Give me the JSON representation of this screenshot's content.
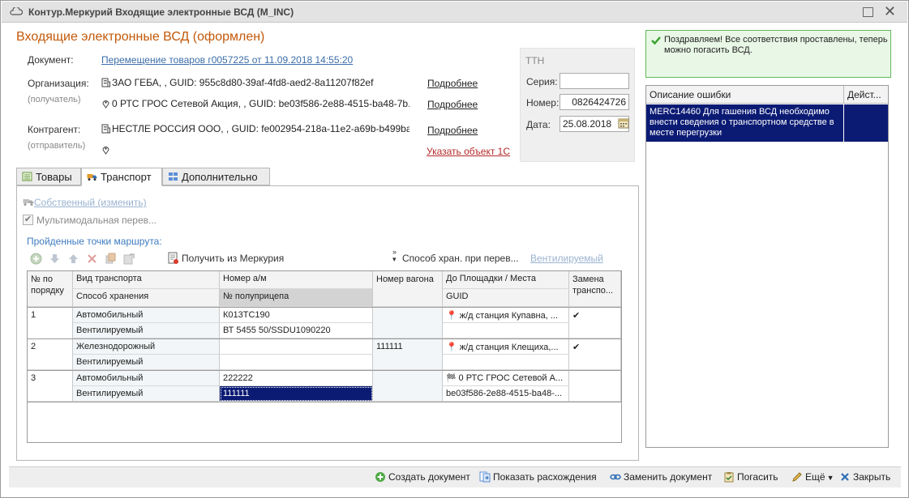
{
  "window": {
    "title": "Контур.Меркурий Входящие электронные ВСД (M_INC)"
  },
  "header": {
    "title": "Входящие электронные ВСД (оформлен)"
  },
  "document": {
    "label": "Документ:",
    "link": "Перемещение товаров г0057225 от 11.09.2018 14:55:20"
  },
  "organization": {
    "label": "Организация:",
    "sublabel": "(получатель)",
    "line1": "ЗАО ГЕБА, , GUID: 955c8d80-39af-4fd8-aed2-8a11207f82ef",
    "line2": "0 РТС ГРОС Сетевой Акция, , GUID: be03f586-2e88-4515-ba48-7b...",
    "more1": "Подробнее",
    "more2": "Подробнее"
  },
  "contragent": {
    "label": "Контрагент:",
    "sublabel": "(отправитель)",
    "line1": "НЕСТЛЕ РОССИЯ ООО, , GUID: fe002954-218a-11e2-a69b-b499ba...",
    "more": "Подробнее",
    "specify": "Указать объект 1С"
  },
  "tth": {
    "title": "ТТН",
    "series_label": "Серия:",
    "series_value": "",
    "number_label": "Номер:",
    "number_value": "0826424726",
    "date_label": "Дата:",
    "date_value": "25.08.2018"
  },
  "tabs": [
    {
      "label": "Товары"
    },
    {
      "label": "Транспорт"
    },
    {
      "label": "Дополнительно"
    }
  ],
  "transport": {
    "own_link": " Собственный (изменить)",
    "multimodal": "Мультимодальная перев...",
    "multimodal_checked": true,
    "route_title": "Пройденные точки маршрута:",
    "get_from_mercury": "Получить из Меркурия",
    "storage_method": "Способ хран. при перев...",
    "storage_value": "Вентилируемый"
  },
  "grid": {
    "headers": {
      "num": "№ по порядку",
      "transport_type": "Вид транспорта",
      "storage": "Способ хранения",
      "car_number": "Номер а/м",
      "trailer": "№ полуприцепа",
      "wagon": "Номер вагона",
      "destination": "До Площадки / Места",
      "guid": "GUID",
      "replace": "Замена транспо..."
    },
    "rows": [
      {
        "num": "1",
        "transport_type": "Автомобильный",
        "storage": "Вентилируемый",
        "car_number": "К013ТС190",
        "trailer": "ВТ 5455 50/SSDU1090220",
        "wagon": "",
        "destination": "ж/д станция Купавна, ...",
        "guid": "",
        "replace": "✔"
      },
      {
        "num": "2",
        "transport_type": "Железнодорожный",
        "storage": "Вентилируемый",
        "car_number": "",
        "trailer": "",
        "wagon": "111111",
        "destination": "ж/д станция Клещиха,...",
        "guid": "",
        "replace": "✔"
      },
      {
        "num": "3",
        "transport_type": "Автомобильный",
        "storage": "Вентилируемый",
        "car_number": "222222",
        "trailer": "111111",
        "wagon": "",
        "destination": "0 РТС ГРОС Сетевой А...",
        "guid": "be03f586-2e88-4515-ba48-...",
        "replace": ""
      }
    ]
  },
  "success": {
    "message": "Поздравляем! Все соответствия проставлены, теперь можно погасить ВСД."
  },
  "errors": {
    "col_description": "Описание ошибки",
    "col_action": "Дейст...",
    "rows": [
      {
        "description": "MERC14460 Для гашения ВСД необходимо внести сведения о транспортном средстве в месте перегрузки",
        "action": ""
      }
    ]
  },
  "bottombar": {
    "create": "Создать документ",
    "show_diff": "Показать расхождения",
    "replace": "Заменить документ",
    "redeem": "Погасить",
    "more": "Ещё",
    "close": "Закрыть"
  },
  "colors": {
    "accent_orange": "#c3590a",
    "link_blue": "#3c6ea8",
    "selection_navy": "#0b1b74",
    "success_green": "#62b95a"
  }
}
